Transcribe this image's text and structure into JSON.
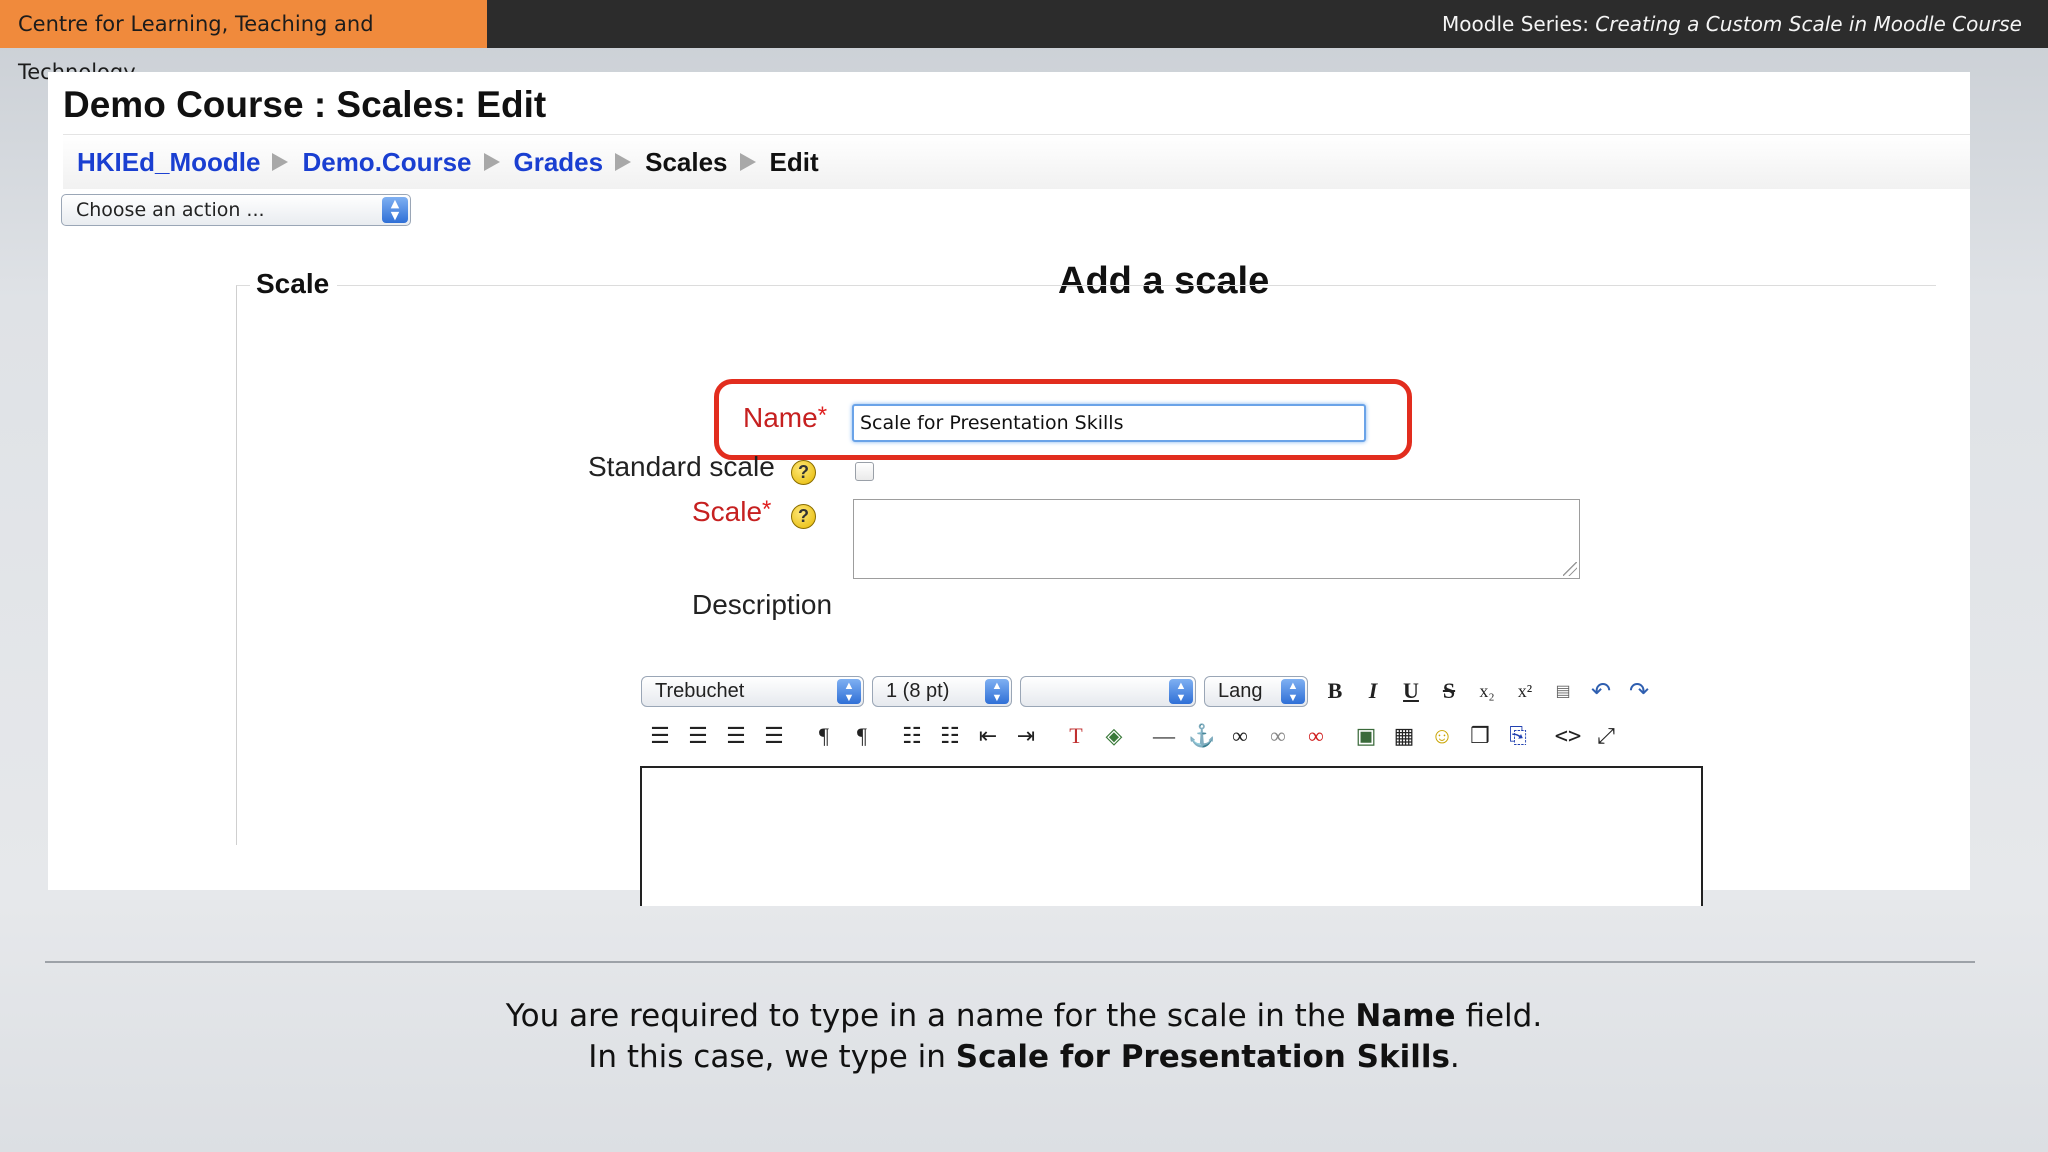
{
  "header": {
    "org": "Centre for Learning, Teaching and Technology",
    "series_prefix": "Moodle Series: ",
    "series_title": "Creating a Custom Scale in Moodle Course"
  },
  "page": {
    "course_title": "Demo Course : Scales: Edit",
    "breadcrumb": [
      "HKIEd_Moodle",
      "Demo.Course",
      "Grades",
      "Scales",
      "Edit"
    ],
    "action_select": "Choose an action ...",
    "heading": "Add a scale"
  },
  "form": {
    "legend": "Scale",
    "name_label": "Name",
    "required_mark": "*",
    "name_value": "Scale for Presentation Skills",
    "standard_label": "Standard scale",
    "scale_label": "Scale",
    "description_label": "Description",
    "help_glyph": "?"
  },
  "editor": {
    "font": "Trebuchet",
    "size": "1 (8 pt)",
    "format": "",
    "lang": "Lang"
  },
  "caption": {
    "line1_pre": "You are required to type in a name for the scale in the ",
    "line1_bold": "Name",
    "line1_post": " field.",
    "line2_pre": "In this case, we type in ",
    "line2_bold": "Scale for Presentation Skills",
    "line2_post": "."
  },
  "colors": {
    "accent_orange": "#f08a3c",
    "link_blue": "#1a3fd1",
    "highlight_red": "#e22d1e",
    "required_red": "#c62020"
  }
}
